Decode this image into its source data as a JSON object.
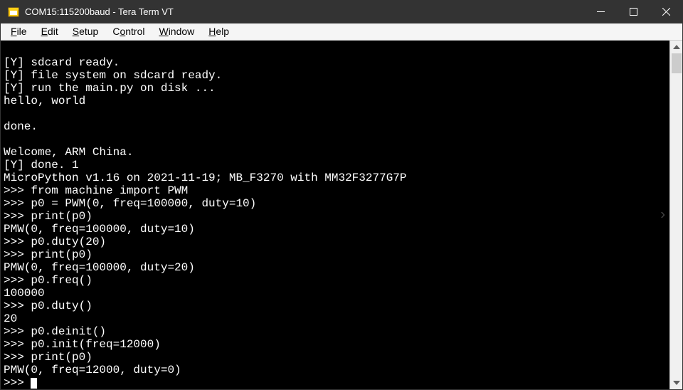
{
  "titlebar": {
    "title": "COM15:115200baud - Tera Term VT"
  },
  "menubar": {
    "items": [
      {
        "label": "File",
        "u": "F"
      },
      {
        "label": "Edit",
        "u": "E"
      },
      {
        "label": "Setup",
        "u": "S"
      },
      {
        "label": "Control",
        "u": "o"
      },
      {
        "label": "Window",
        "u": "W"
      },
      {
        "label": "Help",
        "u": "H"
      }
    ]
  },
  "terminal": {
    "lines": [
      "",
      "[Y] sdcard ready.",
      "[Y] file system on sdcard ready.",
      "[Y] run the main.py on disk ...",
      "hello, world",
      "",
      "done.",
      "",
      "Welcome, ARM China.",
      "[Y] done. 1",
      "MicroPython v1.16 on 2021-11-19; MB_F3270 with MM32F3277G7P",
      ">>> from machine import PWM",
      ">>> p0 = PWM(0, freq=100000, duty=10)",
      ">>> print(p0)",
      "PMW(0, freq=100000, duty=10)",
      ">>> p0.duty(20)",
      ">>> print(p0)",
      "PMW(0, freq=100000, duty=20)",
      ">>> p0.freq()",
      "100000",
      ">>> p0.duty()",
      "20",
      ">>> p0.deinit()",
      ">>> p0.init(freq=12000)",
      ">>> print(p0)",
      "PMW(0, freq=12000, duty=0)"
    ],
    "prompt": ">>> "
  }
}
